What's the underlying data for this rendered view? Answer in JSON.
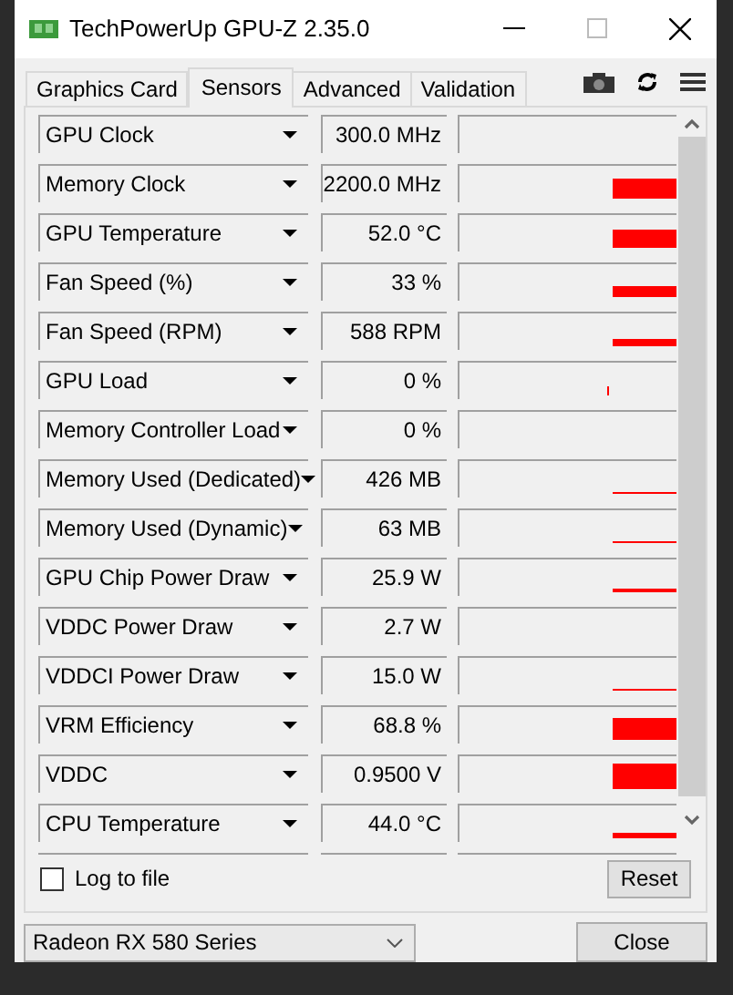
{
  "window": {
    "title": "TechPowerUp GPU-Z 2.35.0"
  },
  "tabs": [
    {
      "label": "Graphics Card",
      "selected": false
    },
    {
      "label": "Sensors",
      "selected": true
    },
    {
      "label": "Advanced",
      "selected": false
    },
    {
      "label": "Validation",
      "selected": false
    }
  ],
  "sensors": [
    {
      "name": "GPU Clock",
      "value": "300.0 MHz"
    },
    {
      "name": "Memory Clock",
      "value": "2200.0 MHz"
    },
    {
      "name": "GPU Temperature",
      "value": "52.0 °C"
    },
    {
      "name": "Fan Speed (%)",
      "value": "33 %"
    },
    {
      "name": "Fan Speed (RPM)",
      "value": "588 RPM"
    },
    {
      "name": "GPU Load",
      "value": "0 %"
    },
    {
      "name": "Memory Controller Load",
      "value": "0 %"
    },
    {
      "name": "Memory Used (Dedicated)",
      "value": "426 MB"
    },
    {
      "name": "Memory Used (Dynamic)",
      "value": "63 MB"
    },
    {
      "name": "GPU Chip Power Draw",
      "value": "25.9 W"
    },
    {
      "name": "VDDC Power Draw",
      "value": "2.7 W"
    },
    {
      "name": "VDDCI Power Draw",
      "value": "15.0 W"
    },
    {
      "name": "VRM Efficiency",
      "value": "68.8 %"
    },
    {
      "name": "VDDC",
      "value": "0.9500 V"
    },
    {
      "name": "CPU Temperature",
      "value": "44.0 °C"
    }
  ],
  "log_to_file": {
    "label": "Log to file",
    "checked": false
  },
  "reset_button": "Reset",
  "gpu_select": {
    "value": "Radeon RX 580 Series"
  },
  "close_button": "Close"
}
